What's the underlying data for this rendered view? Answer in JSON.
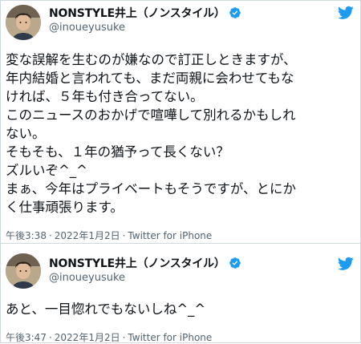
{
  "tweets": [
    {
      "display_name": "NONSTYLE井上（ノンスタイル）",
      "handle": "@inoueyusuke",
      "lines": [
        "変な誤解を生むのが嫌なので訂正しときますが、",
        "年内結婚と言われても、まだ両親に会わせてもな",
        "ければ、５年も付き合ってない。",
        "このニュースのおかげで喧嘩して別れるかもしれ",
        "ない。",
        "そもそも、１年の猶予って長くない？",
        "ズルいぞ^_^",
        "まぁ、今年はプライベートもそうですが、とにか",
        "く仕事頑張ります。"
      ],
      "time": "午後3:38",
      "date": "2022年1月2日",
      "source": "Twitter for iPhone"
    },
    {
      "display_name": "NONSTYLE井上（ノンスタイル）",
      "handle": "@inoueyusuke",
      "lines": [
        "あと、一目惚れでもないしね^_^"
      ],
      "time": "午後3:47",
      "date": "2022年1月2日",
      "source": "Twitter for iPhone"
    }
  ],
  "colors": {
    "text": "#0f1419",
    "secondary": "#536471",
    "verified": "#1d9bf0",
    "twitter_logo": "#1d9bf0",
    "border": "#cfd9de"
  },
  "icons": {
    "verified": "verified-badge-icon",
    "logo": "twitter-bird-icon",
    "avatar": "profile-photo"
  }
}
